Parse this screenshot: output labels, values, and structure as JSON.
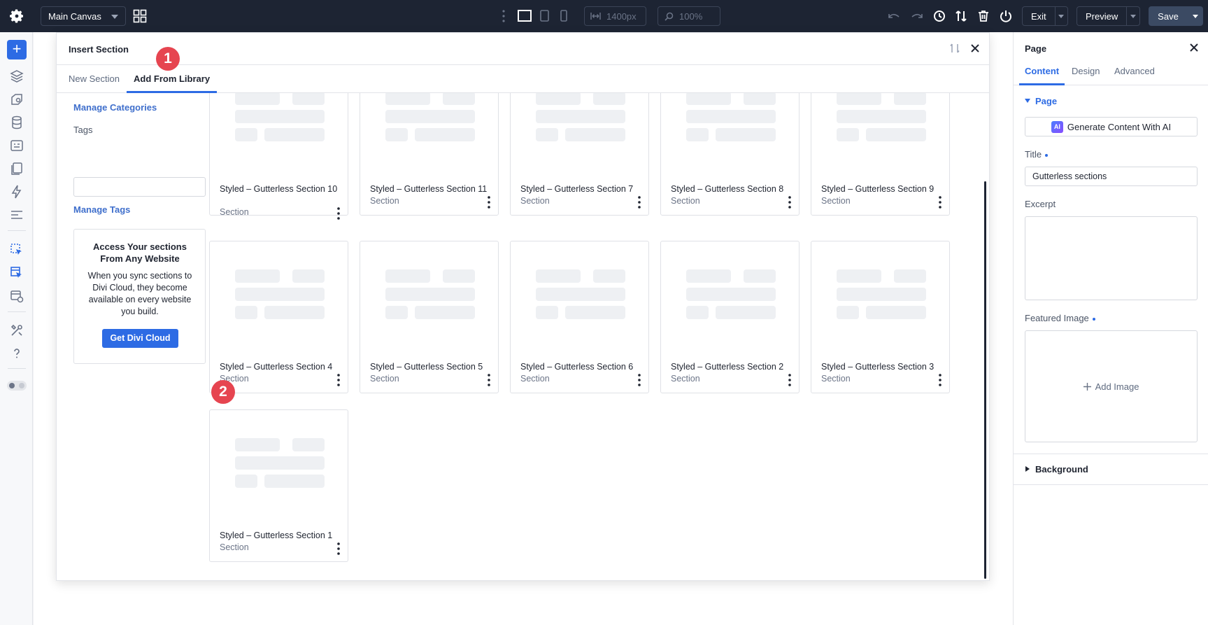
{
  "topbar": {
    "canvas_select": "Main Canvas",
    "width_value": "1400px",
    "zoom_value": "100%",
    "exit_label": "Exit",
    "preview_label": "Preview",
    "save_label": "Save"
  },
  "modal": {
    "title": "Insert Section",
    "tabs": [
      {
        "label": "New Section",
        "active": false
      },
      {
        "label": "Add From Library",
        "active": true
      }
    ],
    "sidebar": {
      "manage_categories": "Manage Categories",
      "tags_label": "Tags",
      "manage_tags": "Manage Tags",
      "cloud_title": "Access Your sections From Any Website",
      "cloud_text": "When you sync sections to Divi Cloud, they become available on every website you build.",
      "cloud_button": "Get Divi Cloud"
    },
    "cards": [
      {
        "title": "Styled – Gutterless Section 10",
        "type": "Section"
      },
      {
        "title": "Styled – Gutterless Section 11",
        "type": "Section"
      },
      {
        "title": "Styled – Gutterless Section 7",
        "type": "Section"
      },
      {
        "title": "Styled – Gutterless Section 8",
        "type": "Section"
      },
      {
        "title": "Styled – Gutterless Section 9",
        "type": "Section"
      },
      {
        "title": "Styled – Gutterless Section 4",
        "type": "Section"
      },
      {
        "title": "Styled – Gutterless Section 5",
        "type": "Section"
      },
      {
        "title": "Styled – Gutterless Section 6",
        "type": "Section"
      },
      {
        "title": "Styled – Gutterless Section 2",
        "type": "Section"
      },
      {
        "title": "Styled – Gutterless Section 3",
        "type": "Section"
      },
      {
        "title": "Styled – Gutterless Section 1",
        "type": "Section"
      }
    ],
    "badges": [
      "1",
      "2"
    ]
  },
  "panel": {
    "title": "Page",
    "tabs": [
      {
        "label": "Content",
        "active": true
      },
      {
        "label": "Design",
        "active": false
      },
      {
        "label": "Advanced",
        "active": false
      }
    ],
    "section_page": "Page",
    "ai_badge": "AI",
    "ai_button": "Generate Content With AI",
    "title_label": "Title",
    "title_value": "Gutterless sections",
    "excerpt_label": "Excerpt",
    "featured_label": "Featured Image",
    "add_image": "Add Image",
    "background_label": "Background"
  },
  "colors": {
    "accent": "#2d6be4",
    "topbar": "#1d2433",
    "badge": "#e64550"
  }
}
